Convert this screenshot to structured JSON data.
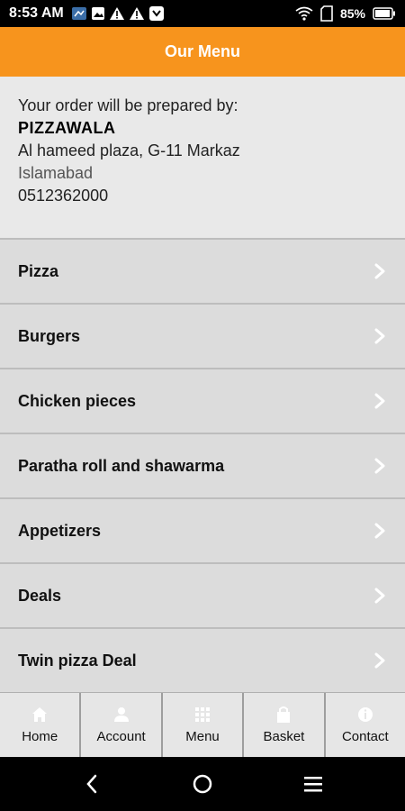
{
  "status_bar": {
    "time": "8:53 AM",
    "battery": "85%"
  },
  "header": {
    "title": "Our Menu"
  },
  "restaurant": {
    "intro": "Your order will be prepared by:",
    "name": "PIZZAWALA",
    "address": "Al hameed plaza, G-11 Markaz",
    "city": "Islamabad",
    "phone": "0512362000"
  },
  "menu": {
    "items": [
      {
        "label": "Pizza"
      },
      {
        "label": "Burgers"
      },
      {
        "label": "Chicken pieces"
      },
      {
        "label": "Paratha roll and shawarma"
      },
      {
        "label": "Appetizers"
      },
      {
        "label": "Deals"
      },
      {
        "label": "Twin pizza Deal"
      }
    ]
  },
  "tabs": [
    {
      "label": "Home",
      "icon": "home-icon"
    },
    {
      "label": "Account",
      "icon": "user-icon"
    },
    {
      "label": "Menu",
      "icon": "grid-icon"
    },
    {
      "label": "Basket",
      "icon": "basket-icon"
    },
    {
      "label": "Contact",
      "icon": "info-icon"
    }
  ],
  "colors": {
    "accent": "#f7941d",
    "background": "#e9e9e9",
    "list_bg": "#dcdcdc"
  }
}
